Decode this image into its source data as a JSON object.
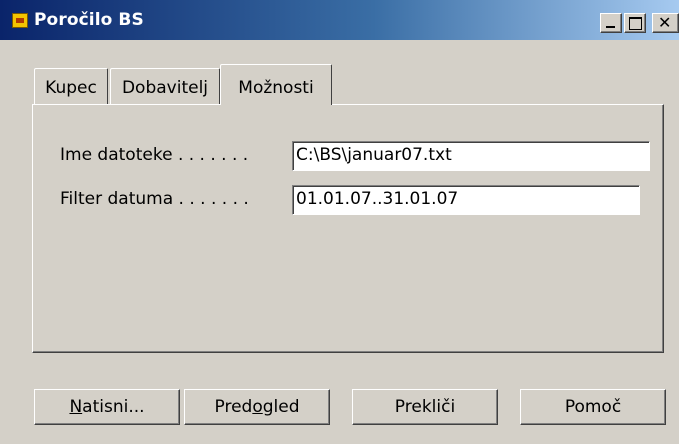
{
  "window": {
    "title": "Poročilo BS",
    "close_glyph": "✕"
  },
  "tabs": [
    {
      "label": "Kupec",
      "selected": false
    },
    {
      "label": "Dobavitelj",
      "selected": false
    },
    {
      "label": "Možnosti",
      "selected": true
    }
  ],
  "fields": {
    "file_label": "Ime datoteke . . . . . . .",
    "file_value": "C:\\BS\\januar07.txt",
    "date_label": "Filter datuma . . . . . . .",
    "date_value": "01.01.07..31.01.07"
  },
  "buttons": {
    "print_hotkey": "N",
    "print_rest": "atisni...",
    "preview_pre": "Pred",
    "preview_hotkey": "o",
    "preview_post": "gled",
    "cancel": "Prekliči",
    "help": "Pomoč"
  },
  "colors": {
    "titlebar_start": "#0a246a",
    "titlebar_end": "#a6caf0",
    "face": "#d4d0c8"
  },
  "icons": {
    "app": "app-icon",
    "minimize": "minimize-icon",
    "maximize": "maximize-icon",
    "close": "close-icon"
  }
}
